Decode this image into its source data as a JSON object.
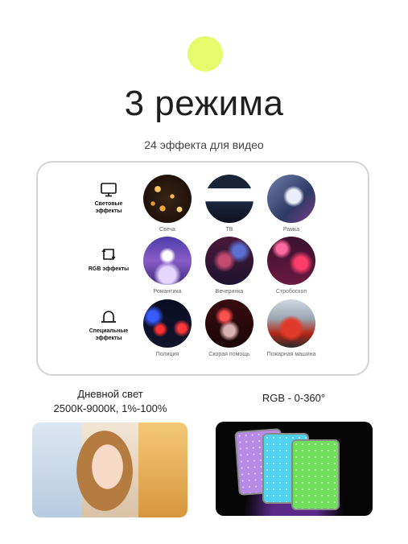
{
  "header": {
    "title": "3 режима",
    "subtitle": "24 эффекта для видео",
    "accent_dot_color": "#e6fb6c"
  },
  "modes": [
    {
      "icon": "monitor-icon",
      "label": "Световые эффекты",
      "effects": [
        "Свеча",
        "ТВ",
        "Рамка"
      ]
    },
    {
      "icon": "rgb-cycle-icon",
      "label": "RGB эффекты",
      "effects": [
        "Романтика",
        "Вечеринка",
        "Стробоскоп"
      ]
    },
    {
      "icon": "siren-icon",
      "label": "Специальные эффекты",
      "effects": [
        "Полиция",
        "Скорая помощь",
        "Пожарная машина"
      ]
    }
  ],
  "bottom": {
    "daylight_title": "Дневной свет",
    "daylight_spec": "2500К-9000К, 1%-100%",
    "rgb_title": "RGB - 0-360°"
  }
}
